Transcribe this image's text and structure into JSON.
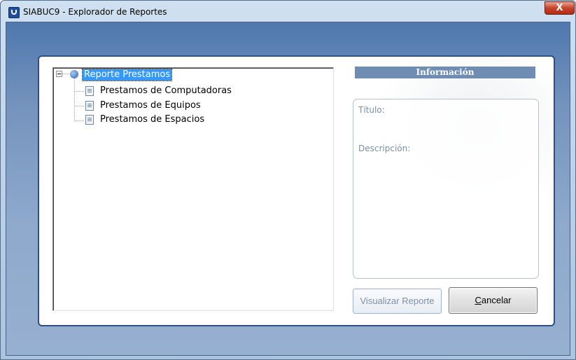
{
  "window": {
    "title": "SIABUC9 - Explorador de Reportes",
    "close_label": "X"
  },
  "tree": {
    "root": {
      "label": "Reporte Prestamos",
      "selected": true,
      "expanded": true
    },
    "children": [
      {
        "label": "Prestamos de Computadoras"
      },
      {
        "label": "Prestamos de Equipos"
      },
      {
        "label": "Prestamos de Espacios"
      }
    ]
  },
  "info": {
    "header": "Información",
    "titulo_label": "Título:",
    "descripcion_label": "Descripción:"
  },
  "buttons": {
    "visualizar": "Visualizar Reporte",
    "cancelar_mnemonic": "C",
    "cancelar_rest": "ancelar"
  },
  "colors": {
    "selection": "#3399ff",
    "info_header_bg": "#6f8db2",
    "panel_border": "#2c4f86"
  }
}
